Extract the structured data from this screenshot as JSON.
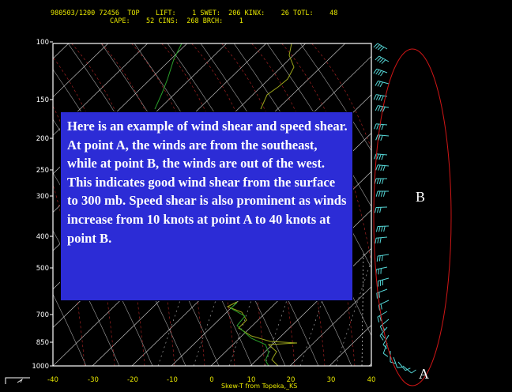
{
  "header": {
    "line1": "980503/1200 72456  TOP    LIFT:    1 SWET:  206 KINX:    26 TOTL:    48",
    "line2": "CAPE:    52 CINS:  268 BRCH:    1"
  },
  "pressure_labels": [
    "100",
    "150",
    "200",
    "250",
    "300",
    "400",
    "500",
    "700",
    "850",
    "1000"
  ],
  "temperature_labels": [
    "-40",
    "-30",
    "-20",
    "-10",
    "0",
    "10",
    "20",
    "30",
    "40"
  ],
  "footer": "Skew-T from Topeka,_KS",
  "overlay_text": "Here is an example of wind shear and speed shear.  At point A, the winds are from the southeast, while at point B, the winds are out of the west.  This indicates good wind shear from the surface to 300 mb.  Speed shear is also prominent as winds increase from 10 knots at point A to 40 knots at point B.",
  "point_labels": {
    "a": "A",
    "b": "B"
  },
  "colors": {
    "background": "#000000",
    "plot_frame": "#ffffff",
    "isotherm": "#ffffff",
    "dry_adiabat": "#c8c8c8",
    "moist_adiabat": "#cc2a2a",
    "temperature_trace": "#9ca61a",
    "dewpoint_trace": "#2aa02a",
    "wind_barbs": "#55d6d6",
    "ellipse": "#d01616",
    "axis_text": "#e6e600",
    "overlay_box": "#2c2cd6"
  }
}
